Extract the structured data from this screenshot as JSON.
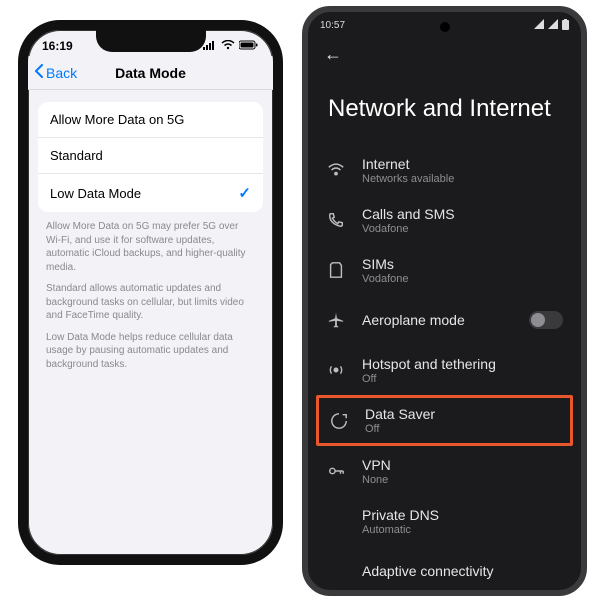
{
  "ios": {
    "status": {
      "time": "16:19",
      "send_icon": "➤"
    },
    "nav": {
      "back": "Back",
      "title": "Data Mode"
    },
    "options": [
      {
        "label": "Allow More Data on 5G",
        "selected": false
      },
      {
        "label": "Standard",
        "selected": false
      },
      {
        "label": "Low Data Mode",
        "selected": true
      }
    ],
    "descriptions": [
      "Allow More Data on 5G may prefer 5G over Wi-Fi, and use it for software updates, automatic iCloud backups, and higher-quality media.",
      "Standard allows automatic updates and background tasks on cellular, but limits video and FaceTime quality.",
      "Low Data Mode helps reduce cellular data usage by pausing automatic updates and background tasks."
    ]
  },
  "android": {
    "status": {
      "time": "10:57",
      "icons": "⏱ ⓘ ⬚ G ⬚",
      "right": "ᯤ ⚡ ▮"
    },
    "back": "←",
    "heading": "Network and Internet",
    "items": [
      {
        "key": "internet",
        "title": "Internet",
        "sub": "Networks available",
        "toggle": false,
        "highlight": false
      },
      {
        "key": "calls",
        "title": "Calls and SMS",
        "sub": "Vodafone",
        "toggle": false,
        "highlight": false
      },
      {
        "key": "sims",
        "title": "SIMs",
        "sub": "Vodafone",
        "toggle": false,
        "highlight": false
      },
      {
        "key": "aeroplane",
        "title": "Aeroplane mode",
        "sub": "",
        "toggle": true,
        "toggle_on": false,
        "highlight": false
      },
      {
        "key": "hotspot",
        "title": "Hotspot and tethering",
        "sub": "Off",
        "toggle": false,
        "highlight": false
      },
      {
        "key": "datasaver",
        "title": "Data Saver",
        "sub": "Off",
        "toggle": false,
        "highlight": true
      },
      {
        "key": "vpn",
        "title": "VPN",
        "sub": "None",
        "toggle": false,
        "highlight": false
      },
      {
        "key": "dns",
        "title": "Private DNS",
        "sub": "Automatic",
        "toggle": false,
        "highlight": false
      },
      {
        "key": "adaptive",
        "title": "Adaptive connectivity",
        "sub": "",
        "toggle": false,
        "highlight": false
      }
    ]
  },
  "colors": {
    "ios_accent": "#007aff",
    "highlight_border": "#e8582c",
    "android_bg": "#1b1b1d"
  }
}
